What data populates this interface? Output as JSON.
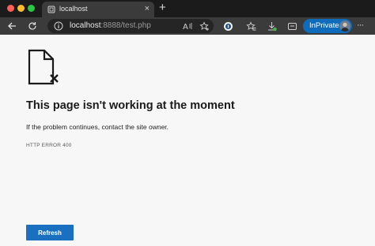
{
  "window": {
    "traffic_lights": [
      "close",
      "minimize",
      "zoom"
    ]
  },
  "tab": {
    "title": "localhost",
    "icon": "page-icon",
    "close_label": "×",
    "new_tab_label": "+"
  },
  "toolbar": {
    "url_host": "localhost",
    "url_rest": ":8888/test.php",
    "icons": [
      "back-icon",
      "reload-icon",
      "info-icon",
      "read-aloud-icon",
      "favorite-add-icon",
      "password-icon",
      "favorites-icon",
      "downloads-icon",
      "collections-icon",
      "more-icon"
    ],
    "inprivate_label": "InPrivate"
  },
  "page": {
    "heading": "This page isn't working at the moment",
    "description": "If the problem continues, contact the site owner.",
    "error_code": "HTTP ERROR 400",
    "refresh_label": "Refresh"
  },
  "colors": {
    "accent": "#0f6cbd",
    "button": "#1a70c0",
    "background": "#f7f7f7",
    "chrome": "#3b3b3b"
  }
}
